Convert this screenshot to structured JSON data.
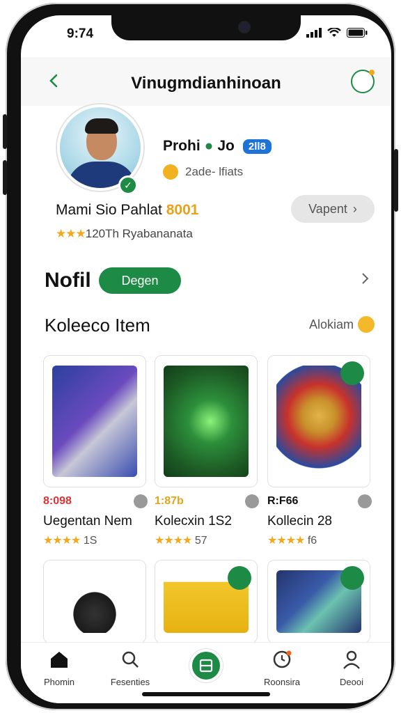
{
  "status": {
    "time": "9:74"
  },
  "header": {
    "title": "Vinugmdianhinoan"
  },
  "profile": {
    "name": "Prohi",
    "name_suffix": "Jo",
    "level_badge": "2ll8",
    "sub": "2ade- lfiats",
    "member_label": "Mami Sio Pahlat",
    "member_points": "8001",
    "rating_stars": "★★★",
    "rating_text": "120Th Ryabananata",
    "view_button": "Vapent"
  },
  "section": {
    "title": "Nofil",
    "pill": "Degen"
  },
  "collection": {
    "title": "Koleeco Item",
    "link": "Alokiam"
  },
  "items": [
    {
      "price": "8:098",
      "name": "Uegentan Nem",
      "stars": "★★★★",
      "rating": "1S"
    },
    {
      "price": "1:87b",
      "name": "Kolecxin 1S2",
      "stars": "★★★★",
      "rating": "57"
    },
    {
      "price": "R:F66",
      "name": "Kollecin 28",
      "stars": "★★★★",
      "rating": "f6"
    }
  ],
  "tabs": [
    {
      "label": "Phomin"
    },
    {
      "label": "Fesenties"
    },
    {
      "label": "Roonsira"
    },
    {
      "label": "Deooi"
    }
  ],
  "colors": {
    "accent": "#1d8a45",
    "gold": "#f2a81d",
    "blue_badge": "#1e73d8"
  }
}
